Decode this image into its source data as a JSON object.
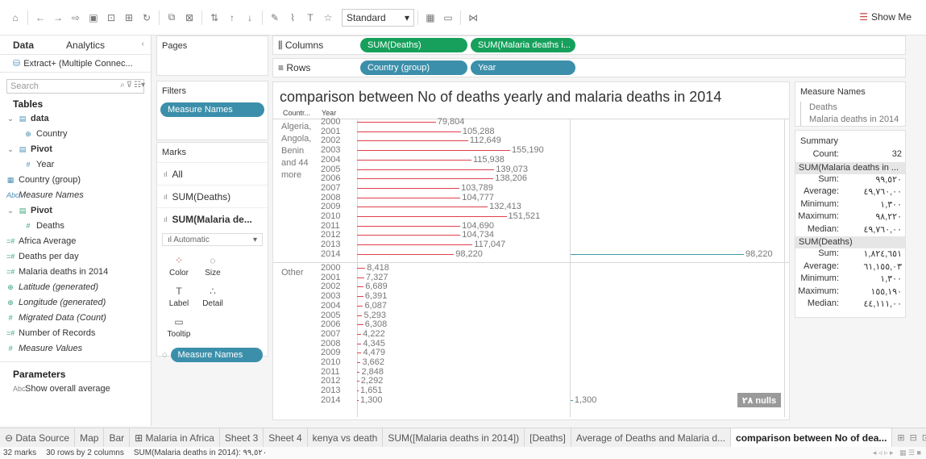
{
  "toolbar": {
    "fit_select": "Standard",
    "show_me": "Show Me"
  },
  "left_pane": {
    "tabs": [
      "Data",
      "Analytics"
    ],
    "source": "Extract+ (Multiple Connec...",
    "search_placeholder": "Search",
    "tables_heading": "Tables",
    "items": [
      {
        "label": "data",
        "icon": "table-icon",
        "indent": 0,
        "style": "bold",
        "glyph": "▤",
        "color": "blue"
      },
      {
        "label": "Country",
        "icon": "globe-icon",
        "indent": 1,
        "style": "",
        "glyph": "⊕",
        "color": "blue"
      },
      {
        "label": "Pivot",
        "icon": "table-icon",
        "indent": 0,
        "style": "bold",
        "glyph": "▤",
        "color": "blue"
      },
      {
        "label": "Year",
        "icon": "number-icon",
        "indent": 1,
        "style": "",
        "glyph": "#",
        "color": "blue"
      },
      {
        "label": "Country (group)",
        "icon": "group-icon",
        "indent": 0,
        "style": "",
        "glyph": "▦",
        "color": "blue"
      },
      {
        "label": "Measure Names",
        "icon": "text-icon",
        "indent": 0,
        "style": "italic",
        "glyph": "Abc",
        "color": "blue"
      },
      {
        "label": "Pivot",
        "icon": "table-icon",
        "indent": 0,
        "style": "bold",
        "glyph": "▤",
        "color": "green"
      },
      {
        "label": "Deaths",
        "icon": "number-icon",
        "indent": 1,
        "style": "",
        "glyph": "#",
        "color": "green"
      },
      {
        "label": "Africa Average",
        "icon": "calc-icon",
        "indent": 0,
        "style": "",
        "glyph": "=#",
        "color": "green"
      },
      {
        "label": "Deaths per day",
        "icon": "calc-icon",
        "indent": 0,
        "style": "",
        "glyph": "=#",
        "color": "green"
      },
      {
        "label": "Malaria deaths in 2014",
        "icon": "calc-icon",
        "indent": 0,
        "style": "",
        "glyph": "=#",
        "color": "green"
      },
      {
        "label": "Latitude (generated)",
        "icon": "globe-icon",
        "indent": 0,
        "style": "italic",
        "glyph": "⊕",
        "color": "green"
      },
      {
        "label": "Longitude (generated)",
        "icon": "globe-icon",
        "indent": 0,
        "style": "italic",
        "glyph": "⊕",
        "color": "green"
      },
      {
        "label": "Migrated Data (Count)",
        "icon": "number-icon",
        "indent": 0,
        "style": "italic",
        "glyph": "#",
        "color": "green"
      },
      {
        "label": "Number of Records",
        "icon": "calc-icon",
        "indent": 0,
        "style": "",
        "glyph": "=#",
        "color": "green"
      },
      {
        "label": "Measure Values",
        "icon": "number-icon",
        "indent": 0,
        "style": "italic",
        "glyph": "#",
        "color": "green"
      }
    ],
    "parameters_heading": "Parameters",
    "parameters": [
      {
        "label": "Show overall average",
        "icon": "text-icon",
        "glyph": "Abc"
      }
    ]
  },
  "cards": {
    "pages_title": "Pages",
    "filters_title": "Filters",
    "filter_pill": "Measure Names",
    "marks_title": "Marks",
    "marks_rows": [
      "All",
      "SUM(Deaths)",
      "SUM(Malaria de..."
    ],
    "mark_type": "Automatic",
    "mark_buttons": [
      {
        "label": "Color",
        "icon": "color-icon",
        "glyph": "⁘"
      },
      {
        "label": "Size",
        "icon": "size-icon",
        "glyph": "◌"
      },
      {
        "label": "Label",
        "icon": "label-icon",
        "glyph": "T"
      },
      {
        "label": "Detail",
        "icon": "detail-icon",
        "glyph": "∴"
      },
      {
        "label": "Tooltip",
        "icon": "tooltip-icon",
        "glyph": "▭"
      }
    ],
    "marks_pill": "Measure Names"
  },
  "shelves": {
    "columns_label": "Columns",
    "columns_pills": [
      "SUM(Deaths)",
      "SUM(Malaria deaths i..."
    ],
    "rows_label": "Rows",
    "rows_pills": [
      "Country (group)",
      "Year"
    ]
  },
  "view": {
    "title": "comparison between No of deaths yearly and malaria deaths in 2014",
    "header_country": "Countr...",
    "header_year": "Year",
    "null_badge": "٢٨ nulls"
  },
  "chart_data": {
    "type": "bar",
    "panels": [
      {
        "name": "Algeria, Angola, Benin and 44 more",
        "label_lines": [
          "Algeria,",
          "Angola,",
          "Benin",
          "and 44",
          "more"
        ],
        "years": [
          "2000",
          "2001",
          "2002",
          "2003",
          "2004",
          "2005",
          "2006",
          "2007",
          "2008",
          "2009",
          "2010",
          "2011",
          "2012",
          "2013",
          "2014"
        ],
        "deaths": [
          79804,
          105288,
          112649,
          155190,
          115938,
          139073,
          138206,
          103789,
          104777,
          132413,
          151521,
          104690,
          104734,
          117047,
          98220
        ],
        "deaths_labels": [
          "79,804",
          "105,288",
          "112,649",
          "155,190",
          "115,938",
          "139,073",
          "138,206",
          "103,789",
          "104,777",
          "132,413",
          "151,521",
          "104,690",
          "104,734",
          "117,047",
          "98,220"
        ],
        "malaria_2014": 98220,
        "malaria_2014_label": "98,220"
      },
      {
        "name": "Other",
        "label_lines": [
          "Other"
        ],
        "years": [
          "2000",
          "2001",
          "2002",
          "2003",
          "2004",
          "2005",
          "2006",
          "2007",
          "2008",
          "2009",
          "2010",
          "2011",
          "2012",
          "2013",
          "2014"
        ],
        "deaths": [
          8418,
          7327,
          6689,
          6391,
          6087,
          5293,
          6308,
          4222,
          4345,
          4479,
          3662,
          2848,
          2292,
          1651,
          1300
        ],
        "deaths_labels": [
          "8,418",
          "7,327",
          "6,689",
          "6,391",
          "6,087",
          "5,293",
          "6,308",
          "4,222",
          "4,345",
          "4,479",
          "3,662",
          "2,848",
          "2,292",
          "1,651",
          "1,300"
        ],
        "malaria_2014": 1300,
        "malaria_2014_label": "1,300"
      }
    ],
    "series": [
      {
        "name": "Deaths",
        "color": "#e0404c"
      },
      {
        "name": "Malaria deaths in 2014",
        "color": "#3a9ba4"
      }
    ]
  },
  "legend": {
    "title": "Measure Names",
    "items": [
      "Deaths",
      "Malaria deaths in 2014"
    ]
  },
  "summary": {
    "title": "Summary",
    "count_label": "Count:",
    "count_value": "32",
    "sections": [
      {
        "header": "SUM(Malaria deaths in ...",
        "rows": [
          {
            "k": "Sum:",
            "v": "٩٩,٥٢٠"
          },
          {
            "k": "Average:",
            "v": "٤٩,٧٦٠,٠٠"
          },
          {
            "k": "Minimum:",
            "v": "١,٣٠٠"
          },
          {
            "k": "Maximum:",
            "v": "٩٨,٢٢٠"
          },
          {
            "k": "Median:",
            "v": "٤٩,٧٦٠,٠٠"
          }
        ]
      },
      {
        "header": "SUM(Deaths)",
        "rows": [
          {
            "k": "Sum:",
            "v": "١,٨٢٤,٦٥١"
          },
          {
            "k": "Average:",
            "v": "٦١,١٥٥,٠٣"
          },
          {
            "k": "Minimum:",
            "v": "١,٣٠٠"
          },
          {
            "k": "Maximum:",
            "v": "١٥٥,١٩٠"
          },
          {
            "k": "Median:",
            "v": "٤٤,١١١,٠٠"
          }
        ]
      }
    ]
  },
  "sheet_tabs": [
    {
      "label": "⊖ Data Source",
      "active": false
    },
    {
      "label": "Map",
      "active": false
    },
    {
      "label": "Bar",
      "active": false
    },
    {
      "label": "⊞ Malaria in Africa",
      "active": false
    },
    {
      "label": "Sheet 3",
      "active": false
    },
    {
      "label": "Sheet 4",
      "active": false
    },
    {
      "label": "kenya vs death",
      "active": false
    },
    {
      "label": "SUM([Malaria deaths in 2014])",
      "active": false
    },
    {
      "label": "[Deaths]",
      "active": false
    },
    {
      "label": "Average of Deaths and Malaria d...",
      "active": false
    },
    {
      "label": "comparison between No of dea...",
      "active": true
    }
  ],
  "status": {
    "marks": "32 marks",
    "rows": "30 rows by 2 columns",
    "sum": "SUM(Malaria deaths in 2014): ٩٩,٥٢٠"
  }
}
